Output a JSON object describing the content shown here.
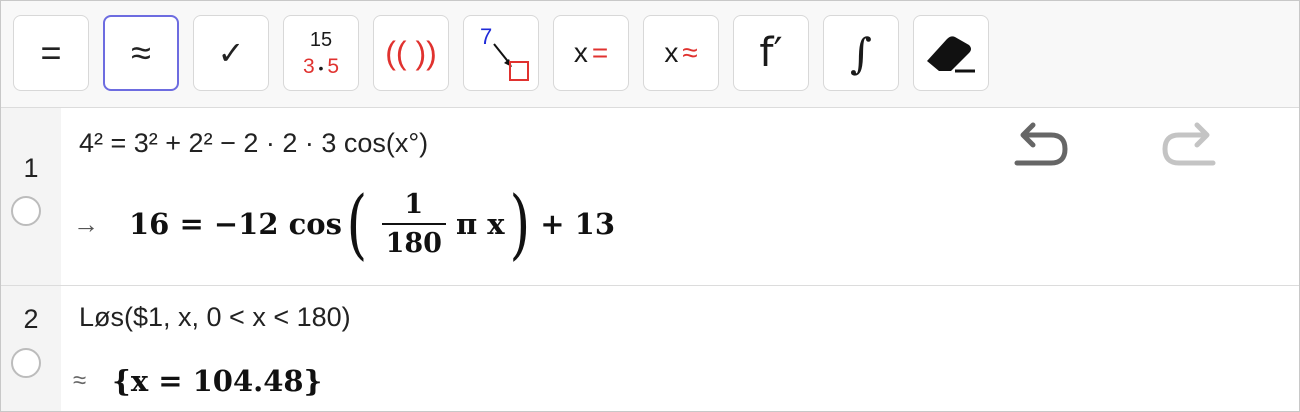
{
  "toolbar": {
    "exact": "=",
    "numeric": "≈",
    "check": "✓",
    "factor": {
      "top": "15",
      "a": "3",
      "dot": " • ",
      "b": "5"
    },
    "expand": "(( ))",
    "substitute": {
      "num": "7"
    },
    "solve": {
      "x": "x",
      "sym": "="
    },
    "nsolve": {
      "x": "x",
      "sym": "≈"
    },
    "derivative": "f′",
    "integral": "∫"
  },
  "rows": [
    {
      "number": "1",
      "input": "4² = 3² + 2² − 2 · 2 · 3  cos(x°)",
      "output_symbol": "→",
      "output": {
        "lhs": "16 = −12  cos",
        "num": "1",
        "den": "180",
        "inner": "π x",
        "rhs": "+ 13"
      }
    },
    {
      "number": "2",
      "input": "Løs($1,  x,  0 < x < 180)",
      "output_symbol": "≈",
      "output": "{x = 104.48}"
    }
  ]
}
